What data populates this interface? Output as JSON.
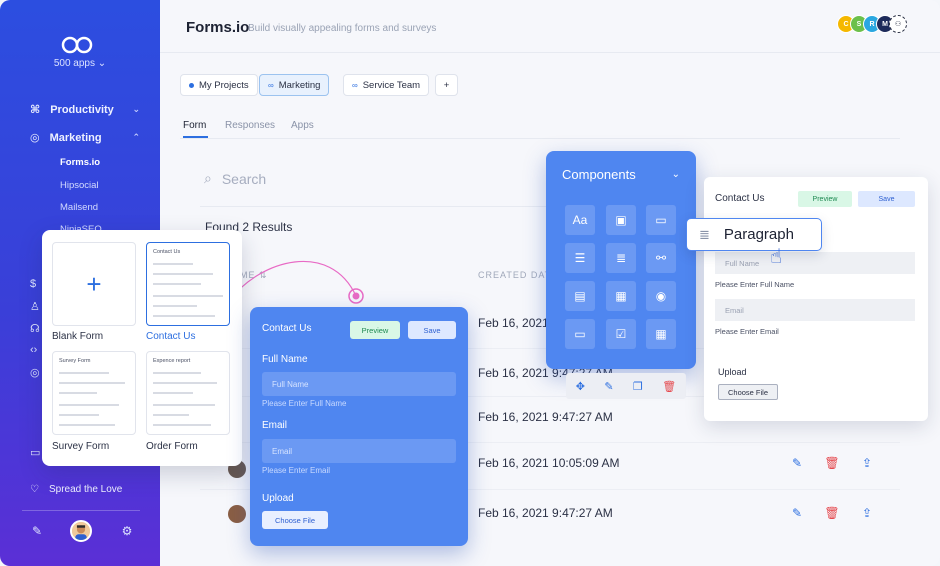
{
  "sidebar": {
    "apps_count": "500 apps",
    "items": [
      {
        "label": "Productivity"
      },
      {
        "label": "Marketing"
      }
    ],
    "sub_items": [
      "Forms.io",
      "Hipsocial",
      "Mailsend",
      "NinjaSEO"
    ],
    "spread": "Spread the Love"
  },
  "header": {
    "title": "Forms.io",
    "subtitle": "Build visually appealing forms and surveys",
    "avatars": [
      "C",
      "S",
      "R",
      "M"
    ]
  },
  "projects": [
    "My Projects",
    "Marketing",
    "Service Team",
    "+"
  ],
  "tabs": [
    "Form",
    "Responses",
    "Apps"
  ],
  "search": {
    "placeholder": "Search"
  },
  "found": "Found 2 Results",
  "columns": [
    "ME",
    "CREATED DAT"
  ],
  "rows": [
    {
      "date": "Feb 16, 2021 9:47:27 AM"
    },
    {
      "date": "Feb 16, 2021 9:47:27 AM"
    },
    {
      "date": "Feb 16, 2021 9:47:27 AM"
    },
    {
      "date": "Feb 16, 2021 10:05:09 AM"
    },
    {
      "date": "Feb 16, 2021 9:47:27 AM"
    }
  ],
  "templates": [
    {
      "label": "Blank Form"
    },
    {
      "label": "Contact Us",
      "mini": "Contact Us"
    },
    {
      "label": "Survey Form",
      "mini": "Survey Form"
    },
    {
      "label": "Order Form",
      "mini": "Expence report"
    }
  ],
  "form_card": {
    "title": "Contact Us",
    "preview": "Preview",
    "save": "Save",
    "full_name_label": "Full Name",
    "full_name_placeholder": "Full Name",
    "full_name_help": "Please Enter Full Name",
    "email_label": "Email",
    "email_placeholder": "Email",
    "email_help": "Please Enter Email",
    "upload_label": "Upload",
    "choose_file": "Choose File"
  },
  "components": {
    "title": "Components",
    "text_icon": "Aa"
  },
  "preview_card": {
    "title": "Contact Us",
    "preview": "Preview",
    "save": "Save",
    "full_name_placeholder": "Full Name",
    "full_name_help": "Please Enter Full Name",
    "email_placeholder": "Email",
    "email_help": "Please Enter Email",
    "upload_label": "Upload",
    "choose_file": "Choose File"
  },
  "paragraph": "Paragraph",
  "colors": {
    "accent": "#2d6fe0",
    "card_blue": "#4f86f0",
    "danger": "#e5484d",
    "preview_green": "#d9f7e6"
  }
}
